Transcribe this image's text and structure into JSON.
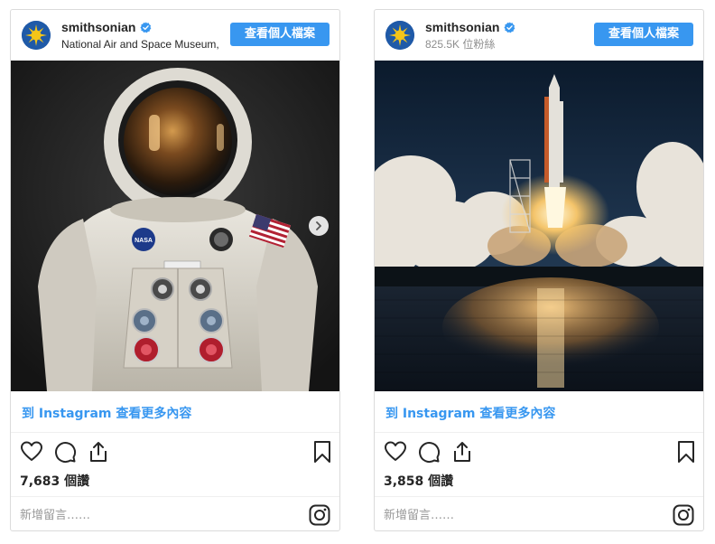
{
  "posts": [
    {
      "username": "smithsonian",
      "subline": "National Air and Space Museum,",
      "profile_button": "查看個人檔案",
      "view_more": "到 Instagram 查看更多內容",
      "likes": "7,683 個讚",
      "comment_placeholder": "新增留言……",
      "image": "astronaut-spacesuit-photo",
      "has_next_arrow": true
    },
    {
      "username": "smithsonian",
      "subline": "825.5K 位粉絲",
      "profile_button": "查看個人檔案",
      "view_more": "到 Instagram 查看更多內容",
      "likes": "3,858 個讚",
      "comment_placeholder": "新增留言……",
      "image": "space-shuttle-launch-photo",
      "has_next_arrow": false
    }
  ],
  "colors": {
    "accent": "#3897f0",
    "text": "#262626",
    "muted": "#8e8e8e",
    "border": "#dbdbdb"
  },
  "icons": [
    "heart-icon",
    "comment-icon",
    "share-icon",
    "bookmark-icon",
    "instagram-icon",
    "chevron-right-icon",
    "verified-badge-icon"
  ]
}
